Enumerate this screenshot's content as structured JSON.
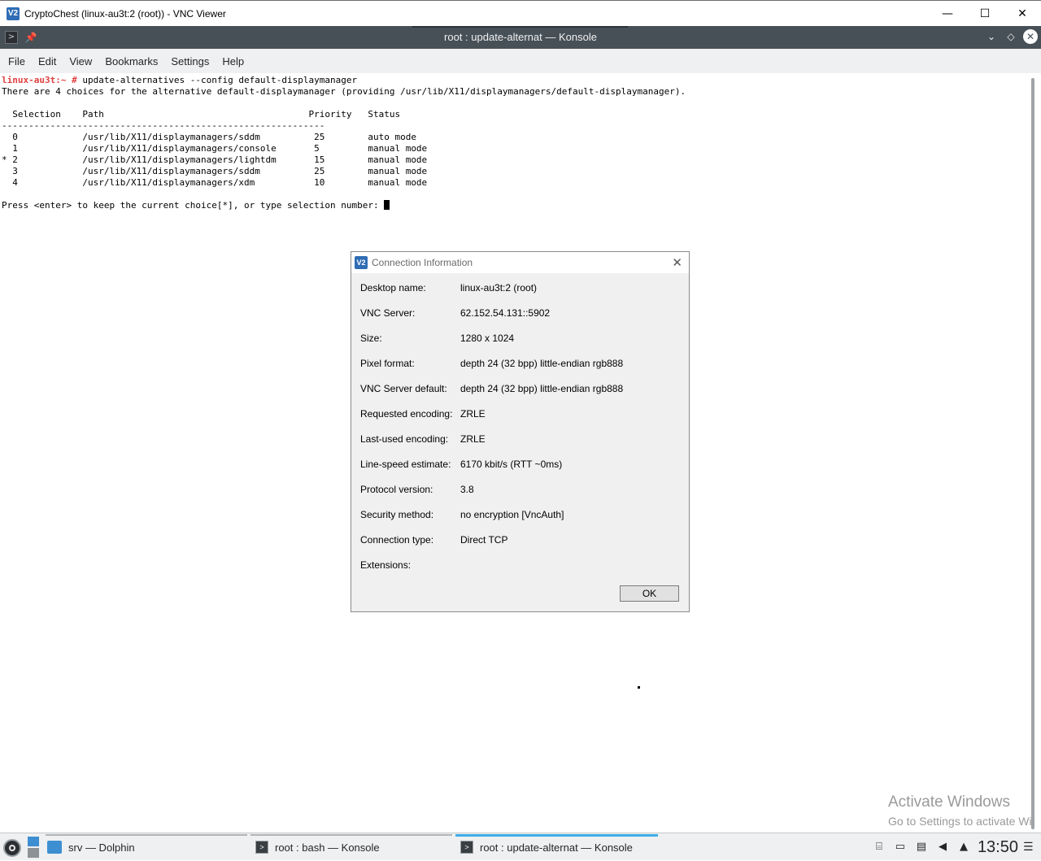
{
  "vnc_window": {
    "title": "CryptoChest (linux-au3t:2 (root)) - VNC Viewer",
    "logo": "V2",
    "minimize": "—",
    "maximize": "☐",
    "close": "✕"
  },
  "konsole": {
    "title": "root : update-alternat — Konsole",
    "menu": [
      "File",
      "Edit",
      "View",
      "Bookmarks",
      "Settings",
      "Help"
    ]
  },
  "terminal": {
    "prompt": "linux-au3t:~ #",
    "command": " update-alternatives --config default-displaymanager",
    "lines": [
      "There are 4 choices for the alternative default-displaymanager (providing /usr/lib/X11/displaymanagers/default-displaymanager).",
      "",
      "  Selection    Path                                      Priority   Status",
      "------------------------------------------------------------",
      "  0            /usr/lib/X11/displaymanagers/sddm          25        auto mode",
      "  1            /usr/lib/X11/displaymanagers/console       5         manual mode",
      "* 2            /usr/lib/X11/displaymanagers/lightdm       15        manual mode",
      "  3            /usr/lib/X11/displaymanagers/sddm          25        manual mode",
      "  4            /usr/lib/X11/displaymanagers/xdm           10        manual mode",
      ""
    ],
    "input_prompt": "Press <enter> to keep the current choice[*], or type selection number: "
  },
  "dialog": {
    "title": "Connection Information",
    "logo": "V2",
    "close": "✕",
    "rows": [
      {
        "label": "Desktop name:",
        "value": "linux-au3t:2 (root)"
      },
      {
        "label": "VNC Server:",
        "value": "62.152.54.131::5902"
      },
      {
        "label": "Size:",
        "value": "1280 x 1024"
      },
      {
        "label": "Pixel format:",
        "value": "depth 24 (32 bpp) little-endian rgb888"
      },
      {
        "label": "VNC Server default:",
        "value": "depth 24 (32 bpp) little-endian rgb888"
      },
      {
        "label": "Requested encoding:",
        "value": "ZRLE"
      },
      {
        "label": "Last-used encoding:",
        "value": "ZRLE"
      },
      {
        "label": "Line-speed estimate:",
        "value": "6170 kbit/s (RTT ~0ms)"
      },
      {
        "label": "Protocol version:",
        "value": "3.8"
      },
      {
        "label": "Security method:",
        "value": "no encryption [VncAuth]"
      },
      {
        "label": "Connection type:",
        "value": "Direct TCP"
      },
      {
        "label": "Extensions:",
        "value": ""
      }
    ],
    "ok_label": "OK"
  },
  "watermark": {
    "line1": "Activate Windows",
    "line2": "Go to Settings to activate Wi"
  },
  "taskbar": {
    "tasks": [
      {
        "label": "srv — Dolphin",
        "icon": "folder-icon"
      },
      {
        "label": "root : bash — Konsole",
        "icon": "konsole-icon"
      },
      {
        "label": "root : update-alternat — Konsole",
        "icon": "konsole-icon"
      }
    ],
    "clock": "13:50"
  },
  "colors": {
    "konsole_titlebar": "#475057",
    "prompt": "#e04040",
    "accent": "#3daee9"
  }
}
